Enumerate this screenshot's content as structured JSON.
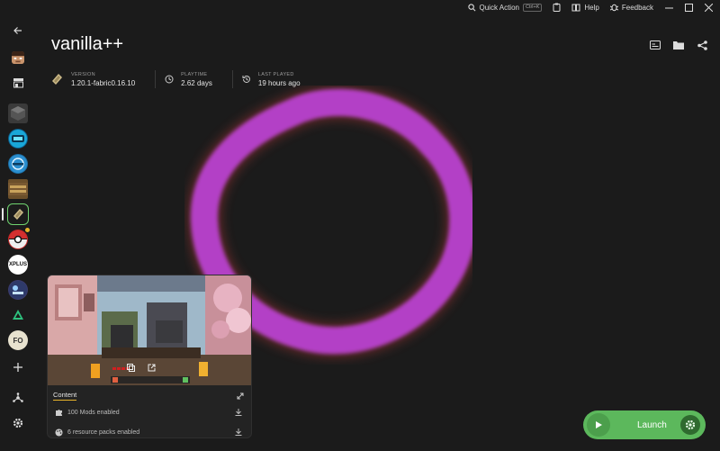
{
  "titlebar": {
    "quick_action": "Quick Action",
    "shortcut": "Ctrl+K",
    "help": "Help",
    "feedback": "Feedback"
  },
  "sidebar": {
    "fo_label": "FO",
    "xplus_label": "XPLUS"
  },
  "instance": {
    "title": "vanilla++",
    "meta": {
      "version_label": "VERSION",
      "version_value": "1.20.1-fabric0.16.10",
      "playtime_label": "PLAYTIME",
      "playtime_value": "2.62 days",
      "lastplayed_label": "LAST PLAYED",
      "lastplayed_value": "19 hours ago"
    }
  },
  "content_card": {
    "tab_label": "Content",
    "rows": [
      {
        "label": "100 Mods enabled",
        "icon": "puzzle-icon"
      },
      {
        "label": "6 resource packs enabled",
        "icon": "palette-icon"
      }
    ]
  },
  "launch": {
    "label": "Launch"
  },
  "colors": {
    "background": "#1b1b1b",
    "accent_green": "#5cb85c",
    "ring": "#b040c0",
    "tab_underline": "#e7b32a"
  }
}
